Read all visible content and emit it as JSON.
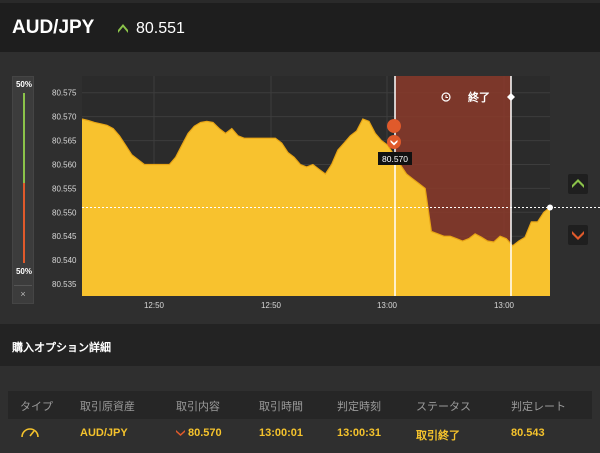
{
  "header": {
    "pair": "AUD/JPY",
    "rate": "80.551",
    "rate_direction": "up"
  },
  "gauge": {
    "top_label": "50%",
    "bottom_label": "50%",
    "up_share": 0.5,
    "close_label": "×"
  },
  "chart": {
    "y_ticks": [
      "80.575",
      "80.570",
      "80.565",
      "80.560",
      "80.555",
      "80.550",
      "80.545",
      "80.540",
      "80.535"
    ],
    "x_ticks": [
      "12:50",
      "12:50",
      "13:00",
      "13:00"
    ],
    "entry_label": "80.570",
    "end_label": "終了",
    "current_rate": 80.551,
    "colors": {
      "area": "#f8c22e",
      "area_stroke": "#e8a515",
      "period": "#8b3a2a",
      "up": "#8bc34a",
      "down": "#e05a2b"
    },
    "series": [
      80.5695,
      80.5692,
      80.5688,
      80.5685,
      80.5682,
      80.5675,
      80.566,
      80.564,
      80.562,
      80.561,
      80.56,
      80.56,
      80.56,
      80.56,
      80.56,
      80.5615,
      80.564,
      80.5665,
      80.568,
      80.5688,
      80.569,
      80.5688,
      80.5675,
      80.5665,
      80.5675,
      80.566,
      80.5655,
      80.5655,
      80.5655,
      80.5655,
      80.5655,
      80.5655,
      80.5645,
      80.5625,
      80.5615,
      80.56,
      80.5595,
      80.56,
      80.559,
      80.558,
      80.56,
      80.563,
      80.5645,
      80.566,
      80.567,
      80.5695,
      80.569,
      80.5665,
      80.565,
      80.564,
      80.562,
      80.56,
      80.558,
      80.557,
      80.556,
      80.555,
      80.546,
      80.5455,
      80.545,
      80.545,
      80.5445,
      80.544,
      80.5445,
      80.5455,
      80.5448,
      80.544,
      80.5438,
      80.545,
      80.5445,
      80.543,
      80.544,
      80.5448,
      80.548,
      80.548,
      80.55,
      80.551
    ]
  },
  "details": {
    "title": "購入オプション詳細",
    "headers": [
      "タイプ",
      "取引原資産",
      "取引内容",
      "取引時間",
      "判定時刻",
      "ステータス",
      "判定レート"
    ],
    "row": {
      "asset": "AUD/JPY",
      "content": "80.570",
      "trade_time": "13:00:01",
      "judge_time": "13:00:31",
      "status": "取引終了",
      "judge_rate": "80.543"
    }
  }
}
